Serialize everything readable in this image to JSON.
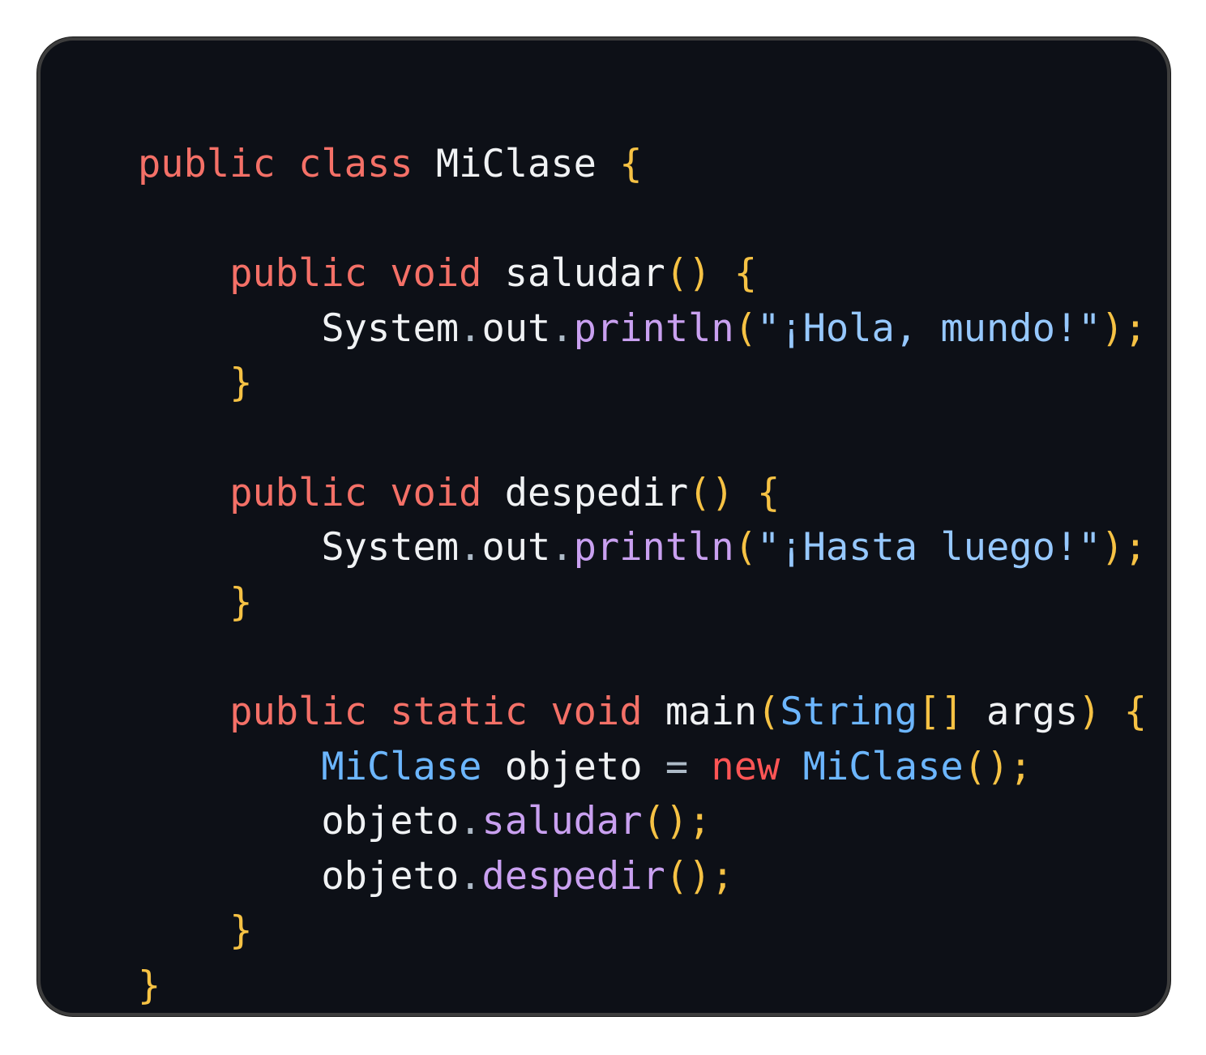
{
  "code": {
    "language": "java",
    "lines": [
      [
        {
          "t": "public",
          "c": "kw"
        },
        {
          "t": " ",
          "c": "plain"
        },
        {
          "t": "class",
          "c": "kw"
        },
        {
          "t": " MiClase ",
          "c": "plain"
        },
        {
          "t": "{",
          "c": "brace"
        }
      ],
      [],
      [
        {
          "t": "    ",
          "c": "plain"
        },
        {
          "t": "public",
          "c": "kw"
        },
        {
          "t": " ",
          "c": "plain"
        },
        {
          "t": "void",
          "c": "kw"
        },
        {
          "t": " saludar",
          "c": "plain"
        },
        {
          "t": "()",
          "c": "brace"
        },
        {
          "t": " ",
          "c": "plain"
        },
        {
          "t": "{",
          "c": "brace"
        }
      ],
      [
        {
          "t": "        System",
          "c": "plain"
        },
        {
          "t": ".",
          "c": "punct"
        },
        {
          "t": "out",
          "c": "plain"
        },
        {
          "t": ".",
          "c": "punct"
        },
        {
          "t": "println",
          "c": "fn"
        },
        {
          "t": "(",
          "c": "brace"
        },
        {
          "t": "\"¡Hola, mundo!\"",
          "c": "str"
        },
        {
          "t": ");",
          "c": "brace"
        }
      ],
      [
        {
          "t": "    ",
          "c": "plain"
        },
        {
          "t": "}",
          "c": "brace"
        }
      ],
      [],
      [
        {
          "t": "    ",
          "c": "plain"
        },
        {
          "t": "public",
          "c": "kw"
        },
        {
          "t": " ",
          "c": "plain"
        },
        {
          "t": "void",
          "c": "kw"
        },
        {
          "t": " despedir",
          "c": "plain"
        },
        {
          "t": "()",
          "c": "brace"
        },
        {
          "t": " ",
          "c": "plain"
        },
        {
          "t": "{",
          "c": "brace"
        }
      ],
      [
        {
          "t": "        System",
          "c": "plain"
        },
        {
          "t": ".",
          "c": "punct"
        },
        {
          "t": "out",
          "c": "plain"
        },
        {
          "t": ".",
          "c": "punct"
        },
        {
          "t": "println",
          "c": "fn"
        },
        {
          "t": "(",
          "c": "brace"
        },
        {
          "t": "\"¡Hasta luego!\"",
          "c": "str"
        },
        {
          "t": ");",
          "c": "brace"
        }
      ],
      [
        {
          "t": "    ",
          "c": "plain"
        },
        {
          "t": "}",
          "c": "brace"
        }
      ],
      [],
      [
        {
          "t": "    ",
          "c": "plain"
        },
        {
          "t": "public",
          "c": "kw"
        },
        {
          "t": " ",
          "c": "plain"
        },
        {
          "t": "static",
          "c": "kw"
        },
        {
          "t": " ",
          "c": "plain"
        },
        {
          "t": "void",
          "c": "kw"
        },
        {
          "t": " main",
          "c": "plain"
        },
        {
          "t": "(",
          "c": "brace"
        },
        {
          "t": "String",
          "c": "type"
        },
        {
          "t": "[]",
          "c": "brace"
        },
        {
          "t": " args",
          "c": "plain"
        },
        {
          "t": ")",
          "c": "brace"
        },
        {
          "t": " ",
          "c": "plain"
        },
        {
          "t": "{",
          "c": "brace"
        }
      ],
      [
        {
          "t": "        ",
          "c": "plain"
        },
        {
          "t": "MiClase",
          "c": "type"
        },
        {
          "t": " objeto ",
          "c": "plain"
        },
        {
          "t": "=",
          "c": "punct"
        },
        {
          "t": " ",
          "c": "plain"
        },
        {
          "t": "new",
          "c": "kw-new"
        },
        {
          "t": " ",
          "c": "plain"
        },
        {
          "t": "MiClase",
          "c": "type"
        },
        {
          "t": "();",
          "c": "brace"
        }
      ],
      [
        {
          "t": "        objeto",
          "c": "plain"
        },
        {
          "t": ".",
          "c": "punct"
        },
        {
          "t": "saludar",
          "c": "fn"
        },
        {
          "t": "();",
          "c": "brace"
        }
      ],
      [
        {
          "t": "        objeto",
          "c": "plain"
        },
        {
          "t": ".",
          "c": "punct"
        },
        {
          "t": "despedir",
          "c": "fn"
        },
        {
          "t": "();",
          "c": "brace"
        }
      ],
      [
        {
          "t": "    ",
          "c": "plain"
        },
        {
          "t": "}",
          "c": "brace"
        }
      ],
      [
        {
          "t": "}",
          "c": "brace"
        }
      ]
    ]
  },
  "colors": {
    "background": "#0d1017",
    "keyword": "#f47067",
    "new_keyword": "#ff5555",
    "identifier": "#f0f2f4",
    "brace": "#f6c244",
    "type": "#6cb6ff",
    "method": "#c9a0f0",
    "string": "#96c8ff"
  }
}
